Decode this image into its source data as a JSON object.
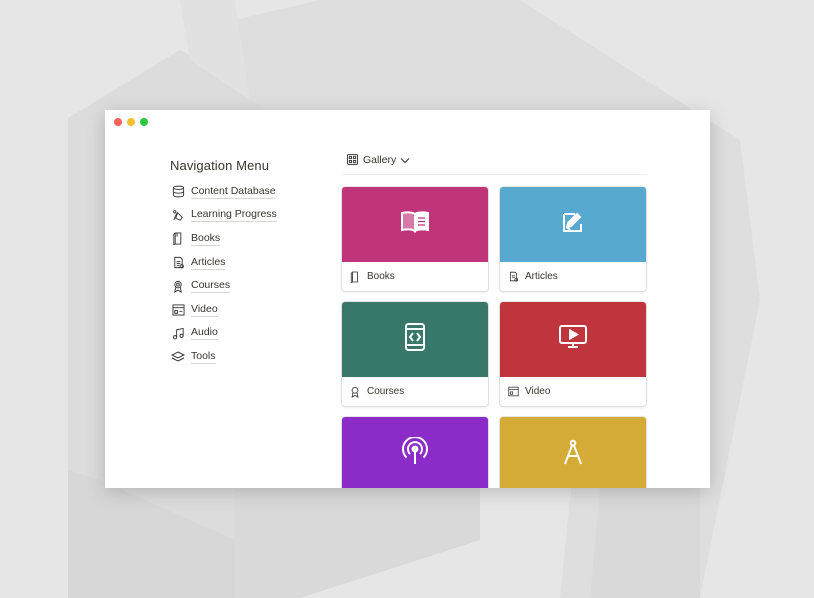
{
  "colors": {
    "books": "#c0357a",
    "articles": "#58a9cf",
    "courses": "#38786b",
    "video": "#c0343d",
    "audio": "#8b2cc9",
    "tools": "#d4ab37"
  },
  "nav": {
    "title": "Navigation Menu",
    "items": [
      {
        "label": "Content Database",
        "icon": "database-icon"
      },
      {
        "label": "Learning Progress",
        "icon": "progress-icon"
      },
      {
        "label": "Books",
        "icon": "book-icon"
      },
      {
        "label": "Articles",
        "icon": "article-icon"
      },
      {
        "label": "Courses",
        "icon": "award-icon"
      },
      {
        "label": "Video",
        "icon": "video-player-icon"
      },
      {
        "label": "Audio",
        "icon": "music-note-icon"
      },
      {
        "label": "Tools",
        "icon": "layers-icon"
      }
    ]
  },
  "view": {
    "label": "Gallery",
    "icon": "gallery-grid-icon"
  },
  "gallery": {
    "cards": [
      {
        "label": "Books",
        "icon": "book-icon",
        "cover_icon": "open-book-icon"
      },
      {
        "label": "Articles",
        "icon": "article-icon",
        "cover_icon": "newspaper-edit-icon"
      },
      {
        "label": "Courses",
        "icon": "award-icon",
        "cover_icon": "mobile-code-icon"
      },
      {
        "label": "Video",
        "icon": "video-player-icon",
        "cover_icon": "play-screen-icon"
      },
      {
        "label": "",
        "icon": "",
        "cover_icon": "podcast-icon"
      },
      {
        "label": "",
        "icon": "",
        "cover_icon": "compass-icon"
      }
    ]
  }
}
